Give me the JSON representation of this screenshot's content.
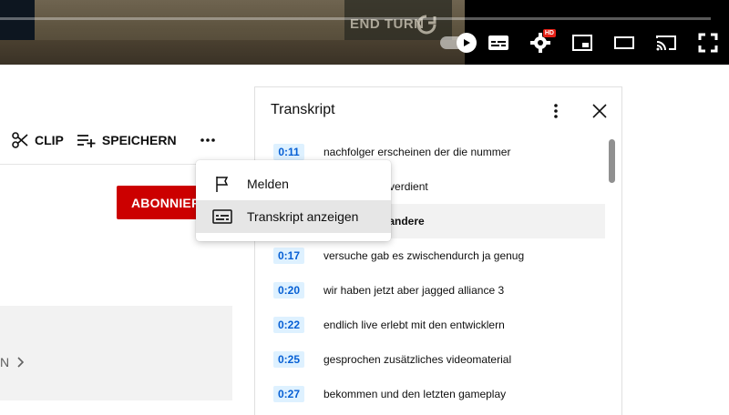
{
  "player": {
    "overlay_text": "END TURN",
    "hd_badge": "HD",
    "controls": [
      "autoplay-toggle",
      "subtitles-icon",
      "settings-icon",
      "miniplayer-icon",
      "theater-icon",
      "cast-icon",
      "fullscreen-icon"
    ]
  },
  "actions": {
    "clip_label": "CLIP",
    "save_label": "SPEICHERN",
    "more_label": "..."
  },
  "channel": {
    "subscribe_label": "ABONNIER"
  },
  "description": {
    "more_label": "N"
  },
  "menu": {
    "items": [
      {
        "label": "Melden",
        "icon": "flag-icon"
      },
      {
        "label": "Transkript anzeigen",
        "icon": "transcript-icon"
      }
    ]
  },
  "transcript": {
    "title": "Transkript",
    "segments": [
      {
        "time": "0:11",
        "text": "nachfolger erscheinen der die nummer"
      },
      {
        "time": "",
        "text": "auch wirklich verdient"
      },
      {
        "time": "",
        "text": "ableger und andere"
      },
      {
        "time": "0:17",
        "text": "versuche gab es zwischendurch ja genug"
      },
      {
        "time": "0:20",
        "text": "wir haben jetzt aber jagged alliance 3"
      },
      {
        "time": "0:22",
        "text": "endlich live erlebt mit den entwicklern"
      },
      {
        "time": "0:25",
        "text": "gesprochen zusätzliches videomaterial"
      },
      {
        "time": "0:27",
        "text": "bekommen und den letzten gameplay"
      }
    ]
  },
  "colors": {
    "subscribe": "#cc0000",
    "timestamp_bg": "#def1ff",
    "timestamp_text": "#065fd4"
  }
}
